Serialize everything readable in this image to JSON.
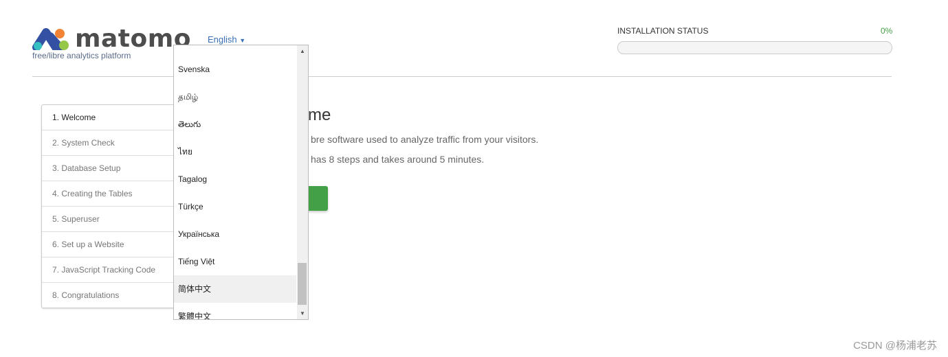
{
  "header": {
    "logo_text": "matomo",
    "tagline": "free/libre analytics platform",
    "language": "English"
  },
  "status": {
    "label": "INSTALLATION STATUS",
    "percent_text": "0%",
    "progress": 0
  },
  "steps": [
    "1. Welcome",
    "2. System Check",
    "3. Database Setup",
    "4. Creating the Tables",
    "5. Superuser",
    "6. Set up a Website",
    "7. JavaScript Tracking Code",
    "8. Congratulations"
  ],
  "main": {
    "heading": "me",
    "line1": "bre software used to analyze traffic from your visitors.",
    "line2": "has 8 steps and takes around 5 minutes."
  },
  "dropdown": {
    "options": [
      "Svenska",
      "தமிழ்",
      "తెలుగు",
      "ไทย",
      "Tagalog",
      "Türkçe",
      "Українська",
      "Tiếng Việt",
      "简体中文",
      "繁體中文"
    ],
    "highlighted": "简体中文"
  },
  "watermark": "CSDN @杨浦老苏"
}
